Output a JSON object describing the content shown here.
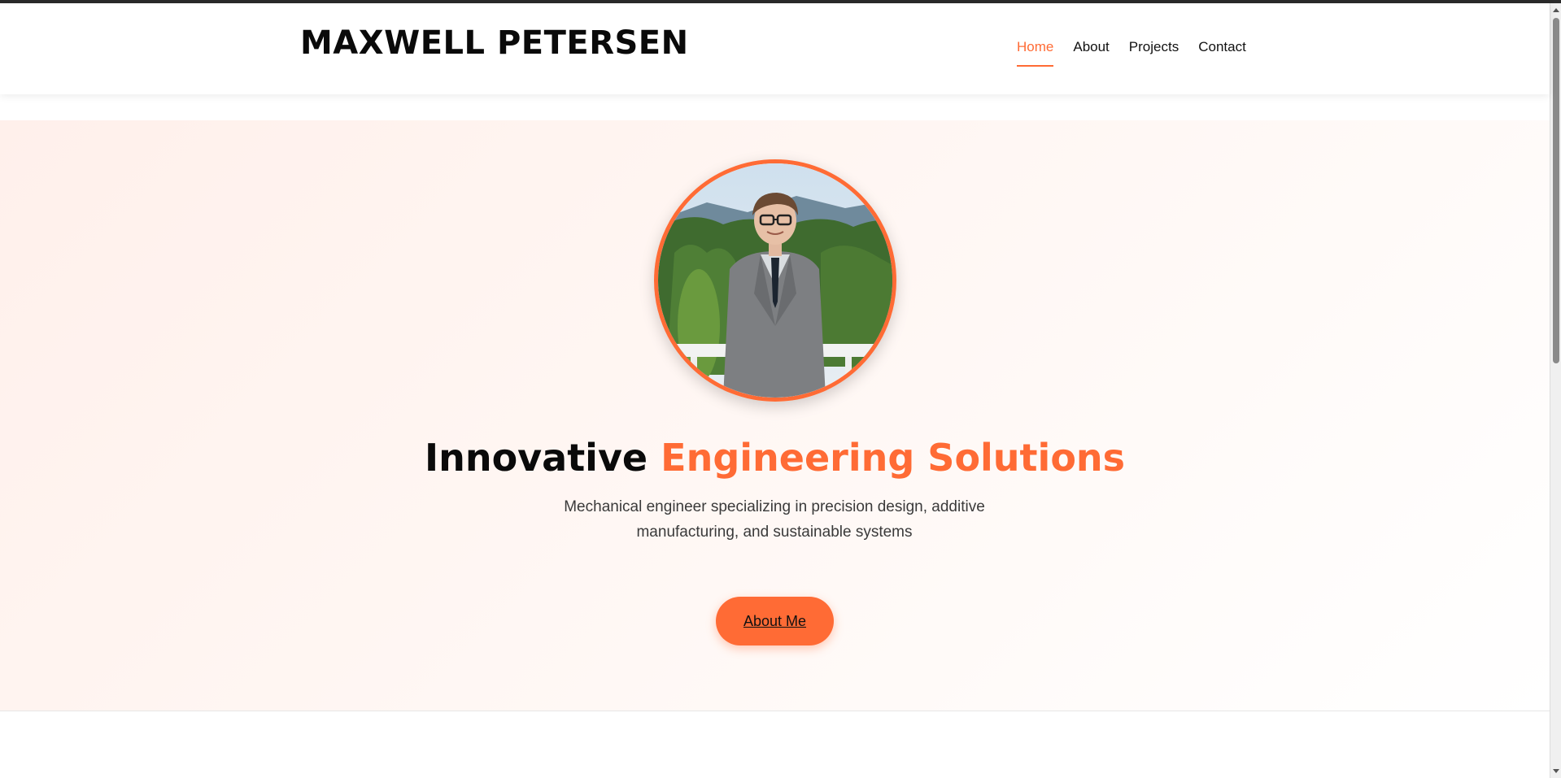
{
  "header": {
    "brand": "MAXWELL PETERSEN",
    "nav": [
      {
        "label": "Home",
        "active": true
      },
      {
        "label": "About",
        "active": false
      },
      {
        "label": "Projects",
        "active": false
      },
      {
        "label": "Contact",
        "active": false
      }
    ]
  },
  "hero": {
    "title_plain": "Innovative",
    "title_accent": "Engineering Solutions",
    "subtitle": "Mechanical engineer specializing in precision design, additive manufacturing, and sustainable systems",
    "cta_label": "About Me"
  },
  "colors": {
    "accent": "#ff6b35",
    "text": "#0a0a0a"
  }
}
